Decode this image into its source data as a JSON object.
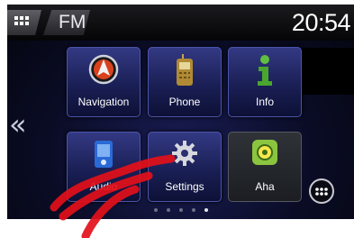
{
  "status_bar": {
    "source_label": "FM",
    "time": "20:54"
  },
  "tiles": [
    {
      "id": "navigation",
      "label": "Navigation",
      "icon": "compass-icon"
    },
    {
      "id": "phone",
      "label": "Phone",
      "icon": "phone-icon"
    },
    {
      "id": "info",
      "label": "Info",
      "icon": "info-icon"
    },
    {
      "id": "audio",
      "label": "Audio",
      "icon": "audio-icon"
    },
    {
      "id": "settings",
      "label": "Settings",
      "icon": "gear-icon"
    },
    {
      "id": "aha",
      "label": "Aha",
      "icon": "aha-icon"
    }
  ],
  "pager": {
    "pages": 5,
    "current_page": 5
  },
  "colors": {
    "tile_top": "#343a84",
    "tile_bottom": "#0d1035",
    "aha_green": "#8bc53f",
    "scribble_red": "#e3101a"
  }
}
